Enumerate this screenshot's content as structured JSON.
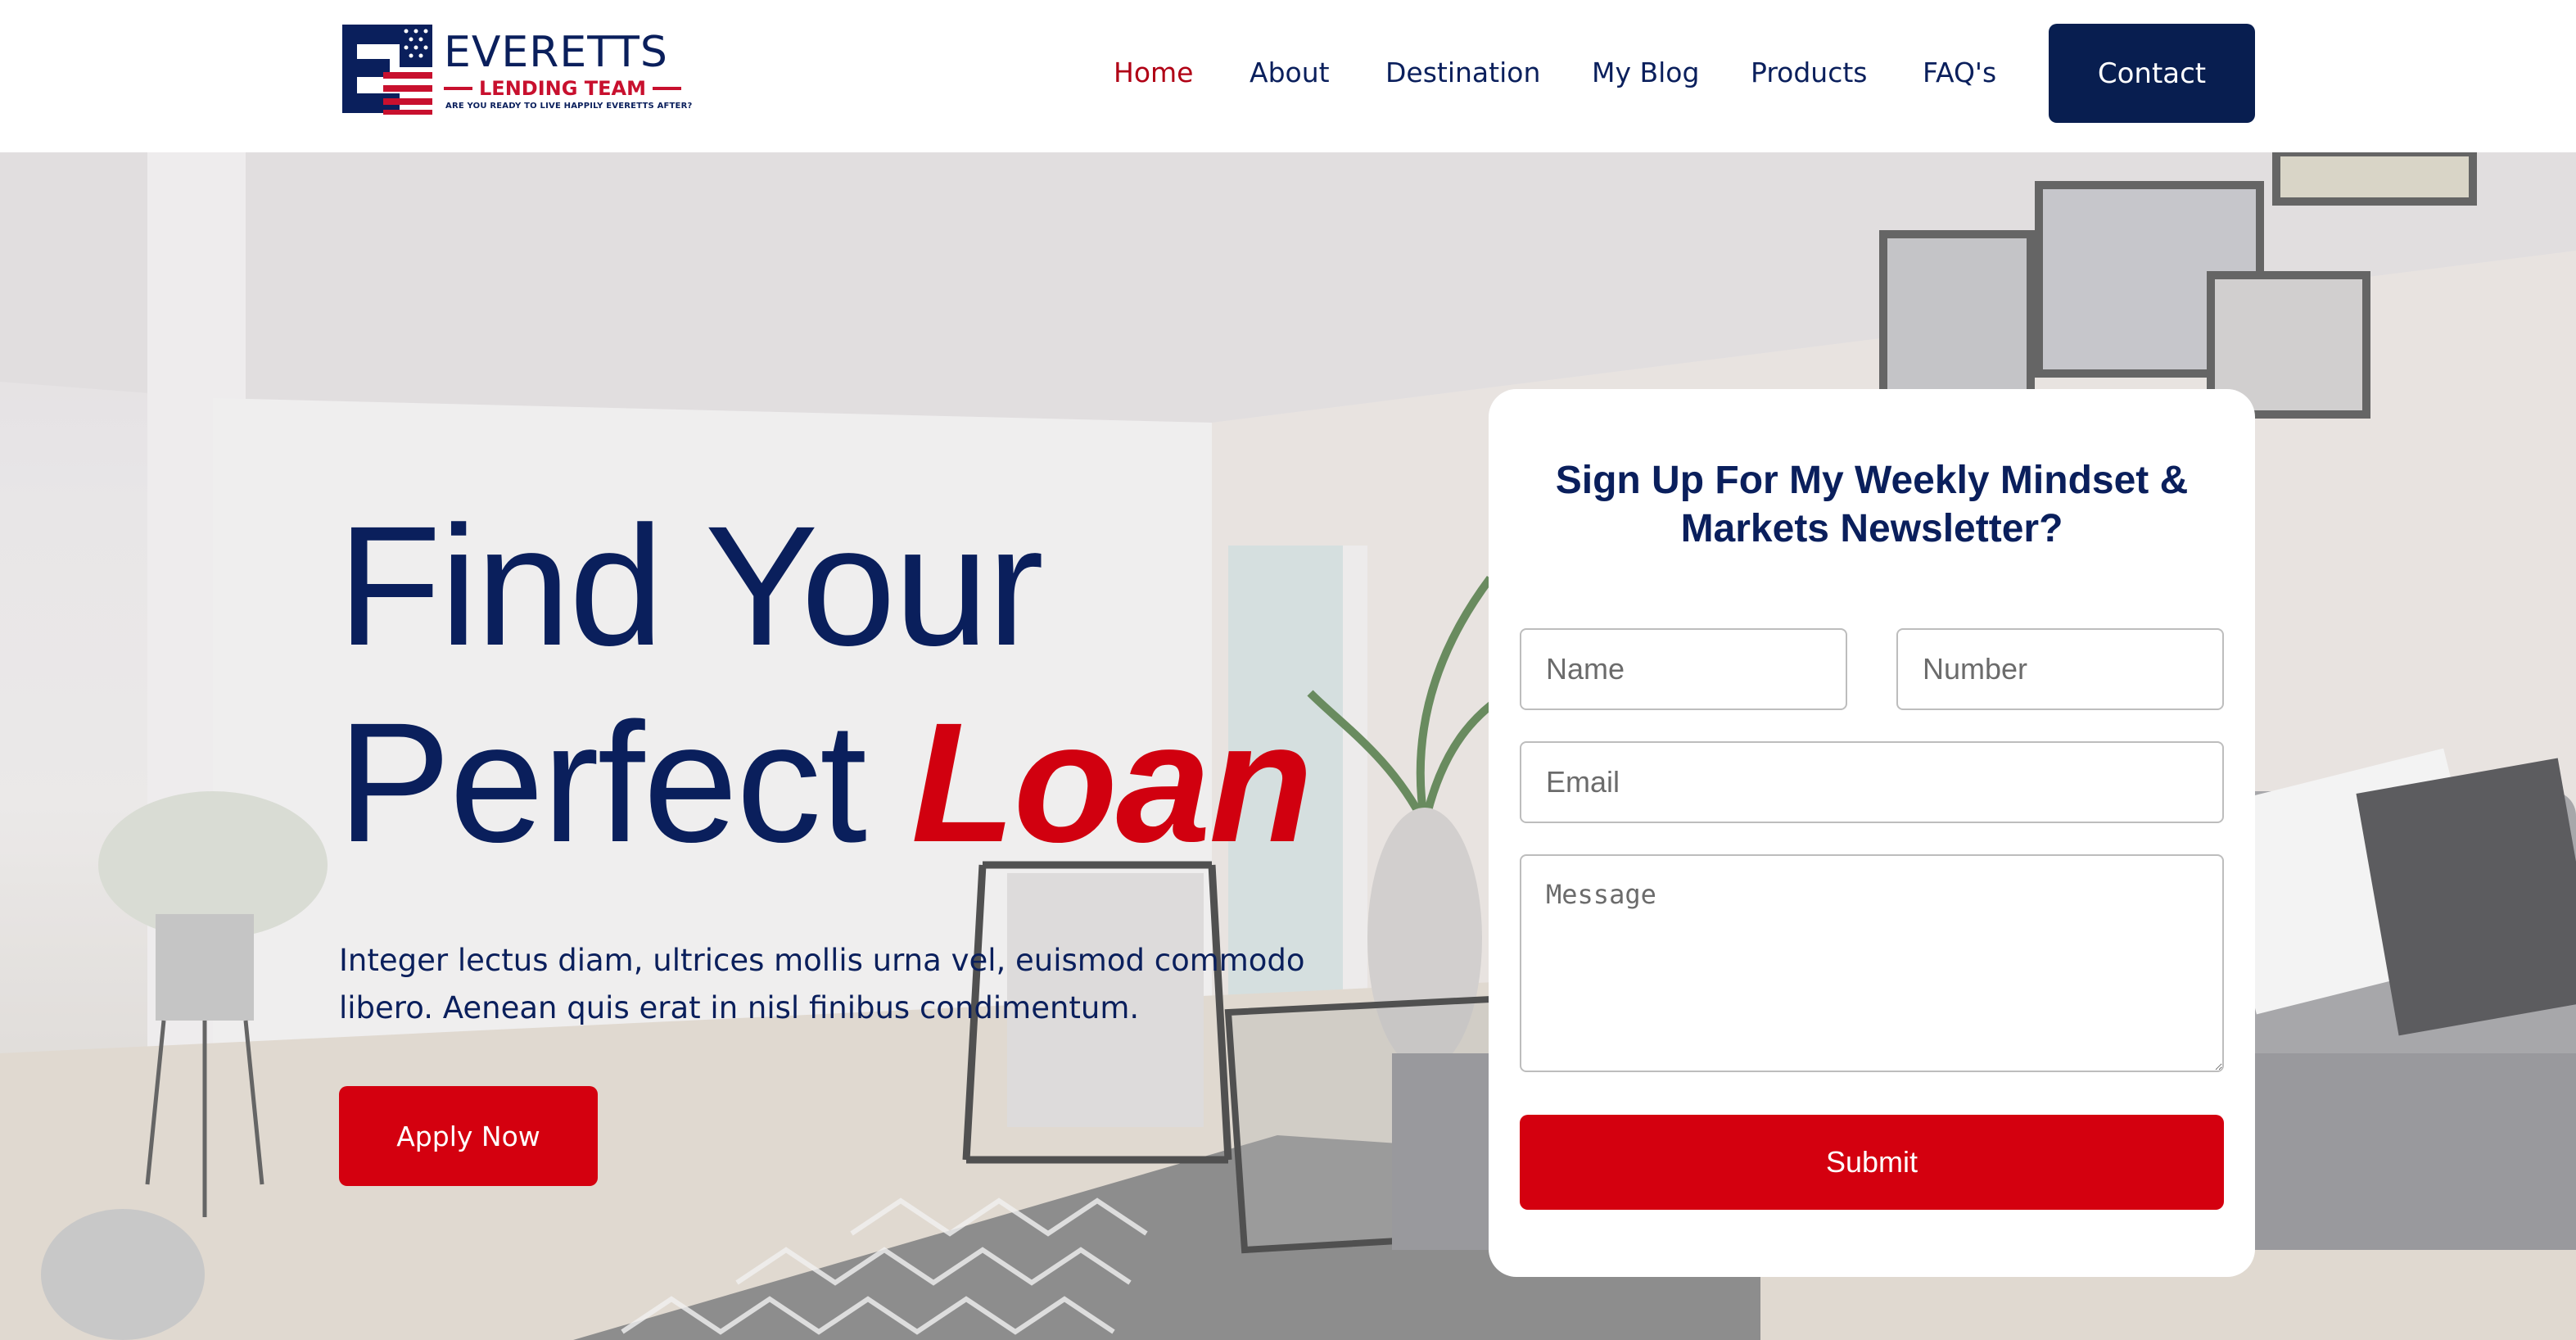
{
  "brand": {
    "name": "EVERETTS",
    "subtitle": "LENDING TEAM",
    "tagline": "ARE YOU READY TO LIVE HAPPILY EVERETTS AFTER?"
  },
  "nav": {
    "items": [
      {
        "label": "Home",
        "active": true
      },
      {
        "label": "About",
        "active": false
      },
      {
        "label": "Destination",
        "active": false
      },
      {
        "label": "My Blog",
        "active": false
      },
      {
        "label": "Products",
        "active": false
      },
      {
        "label": "FAQ's",
        "active": false
      }
    ],
    "contact_label": "Contact"
  },
  "hero": {
    "title_line1": "Find Your",
    "title_line2_prefix": "Perfect",
    "title_accent": "Loan",
    "description": "Integer lectus diam, ultrices mollis urna vel, euismod commodo libero. Aenean quis erat in nisl finibus condimentum.",
    "cta_label": "Apply Now"
  },
  "newsletter": {
    "title": "Sign Up For My Weekly Mindset & Markets Newsletter?",
    "name_placeholder": "Name",
    "number_placeholder": "Number",
    "email_placeholder": "Email",
    "message_placeholder": "Message",
    "submit_label": "Submit"
  },
  "colors": {
    "navy": "#0a1f5c",
    "brand_red": "#d4000f",
    "active_nav_red": "#b00015",
    "contact_button": "#081e50"
  }
}
